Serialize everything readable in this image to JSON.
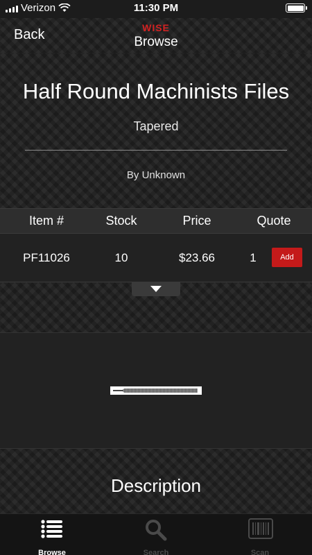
{
  "status": {
    "carrier": "Verizon",
    "time": "11:30 PM"
  },
  "nav": {
    "back_label": "Back",
    "brand": "WISE",
    "title": "Browse"
  },
  "product": {
    "name": "Half Round Machinists Files",
    "subtitle": "Tapered",
    "by": "By Unknown"
  },
  "table": {
    "headers": [
      "Item #",
      "Stock",
      "Price",
      "Quote"
    ],
    "row": {
      "item": "PF11026",
      "stock": "10",
      "price": "$23.66",
      "quote": "1",
      "add_label": "Add"
    }
  },
  "description": {
    "heading": "Description"
  },
  "tabs": [
    {
      "label": "Browse",
      "icon": "list-icon",
      "active": true
    },
    {
      "label": "Search",
      "icon": "search-icon",
      "active": false
    },
    {
      "label": "Scan",
      "icon": "barcode-icon",
      "active": false
    }
  ],
  "colors": {
    "accent": "#c41a1a",
    "brand": "#d42222",
    "background": "#1c1c1c"
  }
}
